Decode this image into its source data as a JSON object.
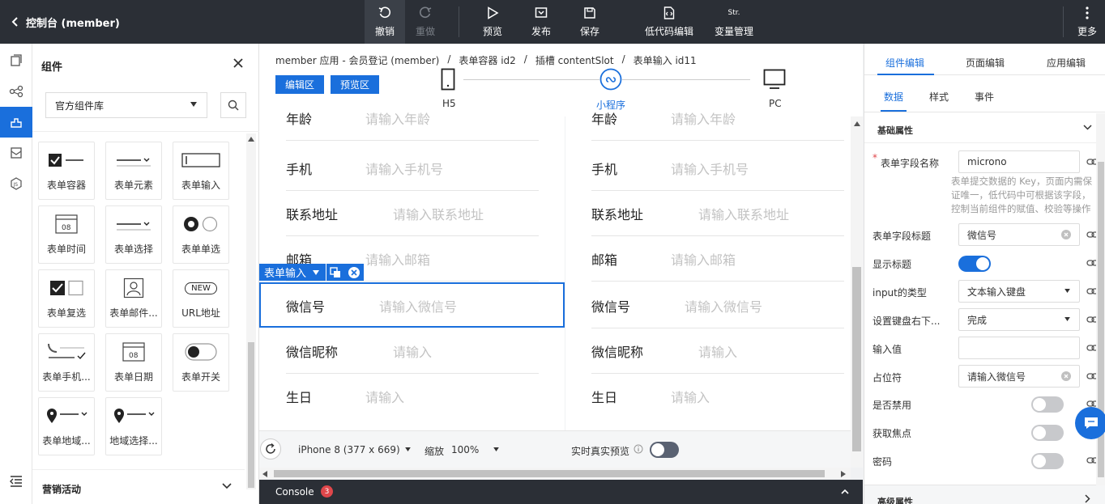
{
  "header": {
    "title": "控制台 (member)",
    "undo": "撤销",
    "redo": "重做",
    "preview": "预览",
    "publish": "发布",
    "save": "保存",
    "lowcode": "低代码编辑",
    "variables": "变量管理",
    "variables_icon_text": "Str.",
    "more": "更多"
  },
  "components_panel": {
    "title": "组件",
    "library": "官方组件库",
    "items": [
      "表单容器",
      "表单元素",
      "表单输入",
      "表单时间",
      "表单选择",
      "表单单选",
      "表单复选",
      "表单邮件...",
      "URL地址",
      "表单手机...",
      "表单日期",
      "表单开关",
      "表单地域...",
      "地域选择..."
    ],
    "url_badge": "NEW",
    "date_badge": "08",
    "section": "营销活动"
  },
  "canvas": {
    "breadcrumb": [
      "member 应用 - 会员登记 (member)",
      "表单容器 id2",
      "插槽 contentSlot",
      "表单输入 id11"
    ],
    "edit_btn": "编辑区",
    "preview_btn": "预览区",
    "devices": [
      "H5",
      "小程序",
      "PC"
    ],
    "rows": [
      {
        "label": "年龄",
        "placeholder": "请输入年龄"
      },
      {
        "label": "手机",
        "placeholder": "请输入手机号"
      },
      {
        "label": "联系地址",
        "placeholder": "请输入联系地址"
      },
      {
        "label": "邮箱",
        "placeholder": "请输入邮箱"
      },
      {
        "label": "微信号",
        "placeholder": "请输入微信号"
      },
      {
        "label": "微信昵称",
        "placeholder": "请输入"
      },
      {
        "label": "生日",
        "placeholder": "请输入"
      }
    ],
    "selected_tag": "表单输入",
    "device_model": "iPhone 8 (377 x 669)",
    "zoom_label": "缩放",
    "zoom_value": "100%",
    "realtime": "实时真实预览",
    "console": "Console",
    "console_count": "3"
  },
  "right_panel": {
    "tabs": [
      "组件编辑",
      "页面编辑",
      "应用编辑"
    ],
    "subtabs": [
      "数据",
      "样式",
      "事件"
    ],
    "section": "基础属性",
    "field_name_label": "表单字段名称",
    "field_name_value": "microno",
    "field_name_help": "表单提交数据的 Key，页面内需保证唯一，低代码中可根据该字段，控制当前组件的赋值、校验等操作",
    "field_title_label": "表单字段标题",
    "field_title_value": "微信号",
    "show_title_label": "显示标题",
    "input_type_label": "input的类型",
    "input_type_value": "文本输入键盘",
    "keyboard_label": "设置键盘右下...",
    "keyboard_value": "完成",
    "value_label": "输入值",
    "placeholder_label": "占位符",
    "placeholder_value": "请输入微信号",
    "disabled_label": "是否禁用",
    "focus_label": "获取焦点",
    "password_label": "密码",
    "advanced": "高级属性"
  },
  "colors": {
    "accent": "#1a6fdc",
    "topbar": "#2b2f36"
  }
}
